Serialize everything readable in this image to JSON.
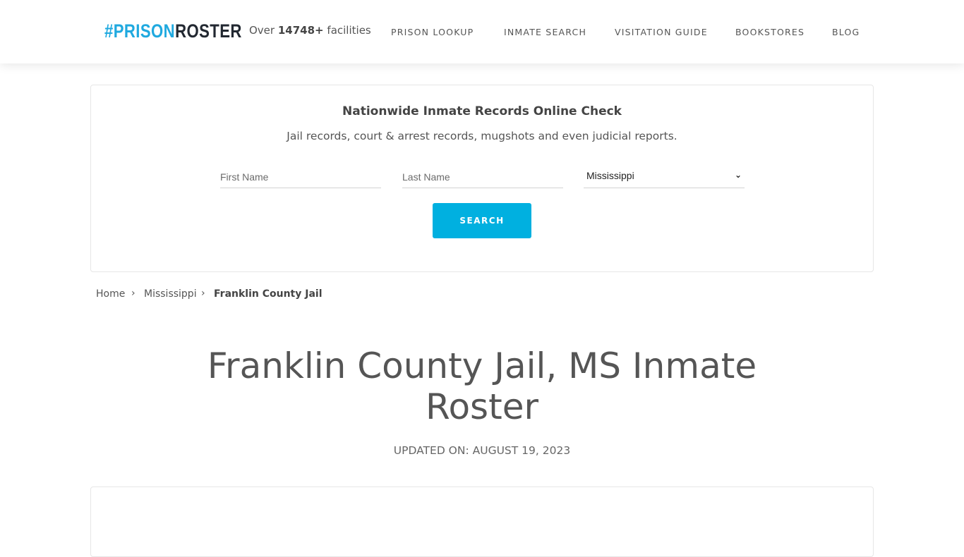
{
  "header": {
    "logo": {
      "hash": "#",
      "prison": "PRISON",
      "roster": "ROSTER"
    },
    "facilities": {
      "prefix": "Over",
      "count": "14748+",
      "suffix": "facilities"
    },
    "nav": [
      {
        "label": "PRISON LOOKUP"
      },
      {
        "label": "INMATE SEARCH"
      },
      {
        "label": "VISITATION GUIDE"
      },
      {
        "label": "BOOKSTORES"
      },
      {
        "label": "BLOG"
      }
    ]
  },
  "search_card": {
    "title": "Nationwide Inmate Records Online Check",
    "subtitle": "Jail records, court & arrest records, mugshots and even judicial reports.",
    "first_name": {
      "placeholder": "First Name",
      "value": ""
    },
    "last_name": {
      "placeholder": "Last Name",
      "value": ""
    },
    "state": {
      "selected": "Mississippi",
      "icon": "chevron-down-icon"
    },
    "button_label": "SEARCH"
  },
  "breadcrumb": [
    {
      "label": "Home"
    },
    {
      "label": "Mississippi"
    },
    {
      "label": "Franklin County Jail"
    }
  ],
  "breadcrumb_separator": "›",
  "page": {
    "title": "Franklin County Jail, MS Inmate Roster",
    "updated": "UPDATED ON: AUGUST 19, 2023"
  },
  "colors": {
    "brand_blue": "#1fa9df",
    "brand_dark": "#222831",
    "button": "#00b0e0"
  }
}
